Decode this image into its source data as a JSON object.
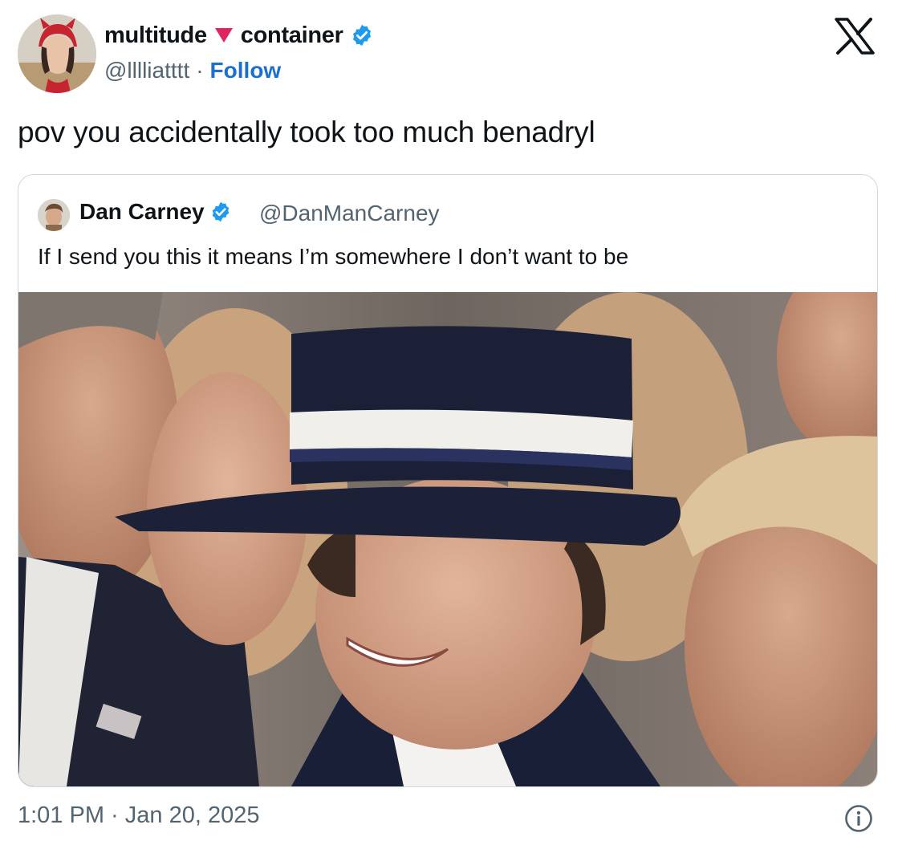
{
  "author": {
    "name_part1": "multitude",
    "name_part2": "container",
    "handle": "@lllliatttt",
    "separator": "·",
    "follow_label": "Follow"
  },
  "tweet": {
    "text": "pov you accidentally took too much benadryl",
    "timestamp": "1:01 PM · Jan 20, 2025"
  },
  "quoted": {
    "name": "Dan Carney",
    "handle": "@DanManCarney",
    "text": "If I send you this it means I’m somewhere I don’t want to be"
  },
  "icons": {
    "platform_logo": "x-logo-icon",
    "verified": "verified-badge-icon",
    "info": "info-icon",
    "heart": "red-heart-triangle-icon"
  },
  "colors": {
    "link_blue": "#1d6fcf",
    "verified_blue": "#1d9bf0",
    "muted": "#536471",
    "heart_red": "#e0245e"
  }
}
